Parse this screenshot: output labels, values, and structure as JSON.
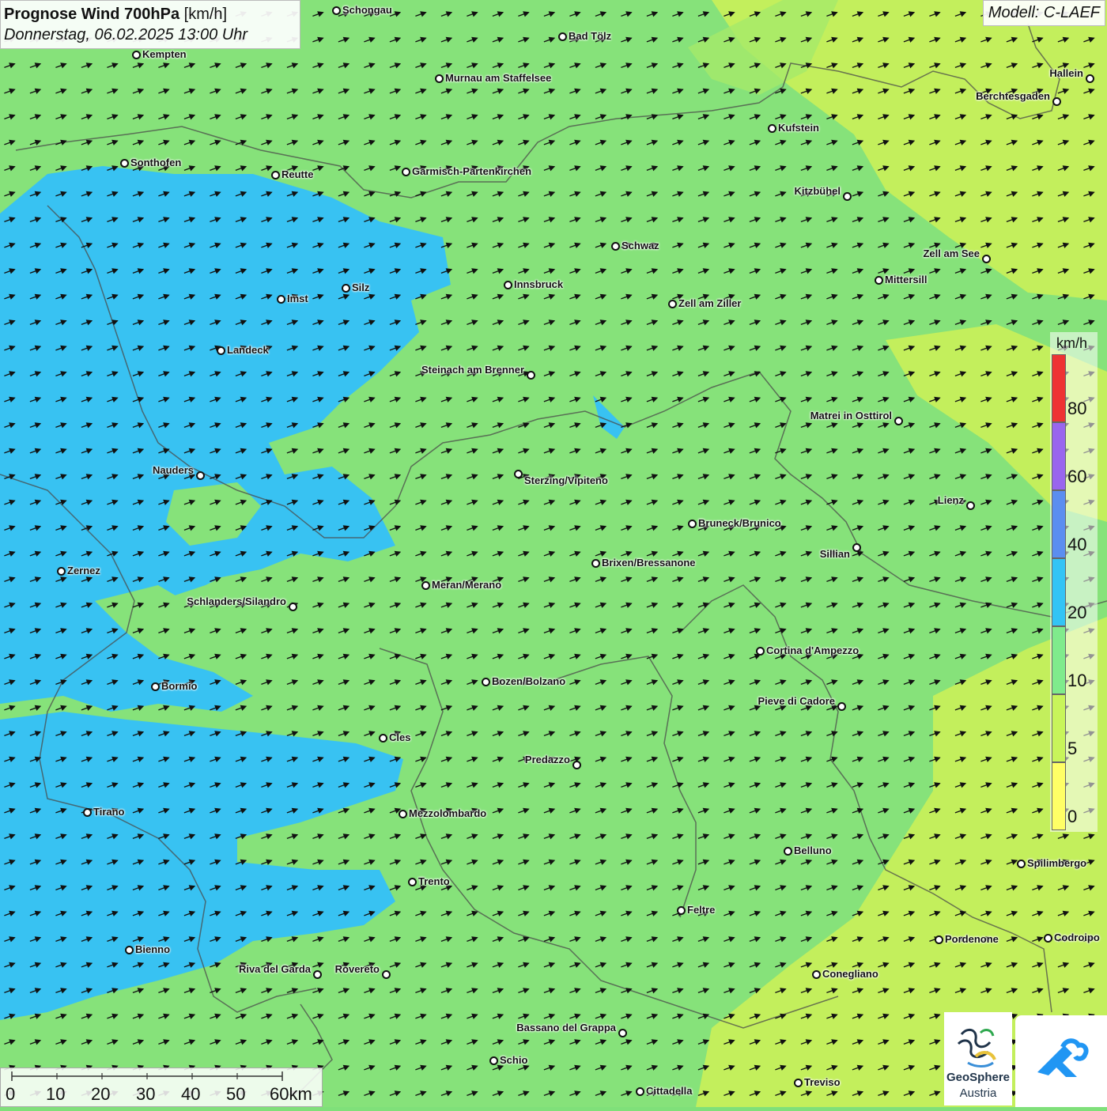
{
  "header": {
    "title_bold": "Prognose Wind 700hPa",
    "title_unit": "[km/h]",
    "datetime": "Donnerstag, 06.02.2025 13:00 Uhr"
  },
  "model": "Modell: C-LAEF",
  "cities": [
    "Schongau",
    "Bad Tölz",
    "Kempten",
    "Murnau am Staffelsee",
    "Hallein",
    "Berchtesgaden",
    "Kufstein",
    "Sonthofen",
    "Reutte",
    "Garmisch-Partenkirchen",
    "Kitzbühel",
    "Schwaz",
    "Zell am See",
    "Innsbruck",
    "Mittersill",
    "Silz",
    "Imst",
    "Zell am Ziller",
    "Landeck",
    "Steinach am Brenner",
    "Matrei in Osttirol",
    "Nauders",
    "Sterzing/Vipiteno",
    "Lienz",
    "Bruneck/Brunico",
    "Sillian",
    "Brixen/Bressanone",
    "Zernez",
    "Meran/Merano",
    "Schlanders/Silandro",
    "Cortina d'Ampezzo",
    "Bozen/Bolzano",
    "Bormio",
    "Pieve di Cadore",
    "Cles",
    "Predazzo",
    "Tirano",
    "Mezzolombardo",
    "Belluno",
    "Spilimbergo",
    "Trento",
    "Feltre",
    "Pordenone",
    "Codroipo",
    "Bienno",
    "Riva del Garda",
    "Rovereto",
    "Conegliano",
    "Bassano del Grappa",
    "Schio",
    "Treviso",
    "Cittadella"
  ],
  "legend": {
    "unit": "km/h",
    "bands": [
      {
        "from": 0,
        "to": 5,
        "color": "#ffff66"
      },
      {
        "from": 5,
        "to": 10,
        "color": "#c8f55a"
      },
      {
        "from": 10,
        "to": 20,
        "color": "#7feb8c"
      },
      {
        "from": 20,
        "to": 40,
        "color": "#33c4f5"
      },
      {
        "from": 40,
        "to": 60,
        "color": "#5b8ef0"
      },
      {
        "from": 60,
        "to": 80,
        "color": "#9966ee"
      },
      {
        "from": 80,
        "to": 100,
        "color": "#ee3333"
      }
    ],
    "ticks": [
      "0",
      "5",
      "10",
      "20",
      "40",
      "60",
      "80"
    ]
  },
  "scalebar": {
    "labels": [
      "0",
      "10",
      "20",
      "30",
      "40",
      "50",
      "60km"
    ]
  },
  "logos": {
    "geosphere_name": "GeoSphere",
    "geosphere_sub": "Austria",
    "geosphere_icon": "geosphere-logo-icon",
    "app_icon": "weather-app-logo-icon"
  },
  "wind": {
    "prevailing_direction": "from west-southwest"
  },
  "colors": {
    "background_field": "#7fe07a",
    "light_field": "#c8f55a",
    "blue_field": "#33c4f5",
    "border_lines": "#555555"
  }
}
